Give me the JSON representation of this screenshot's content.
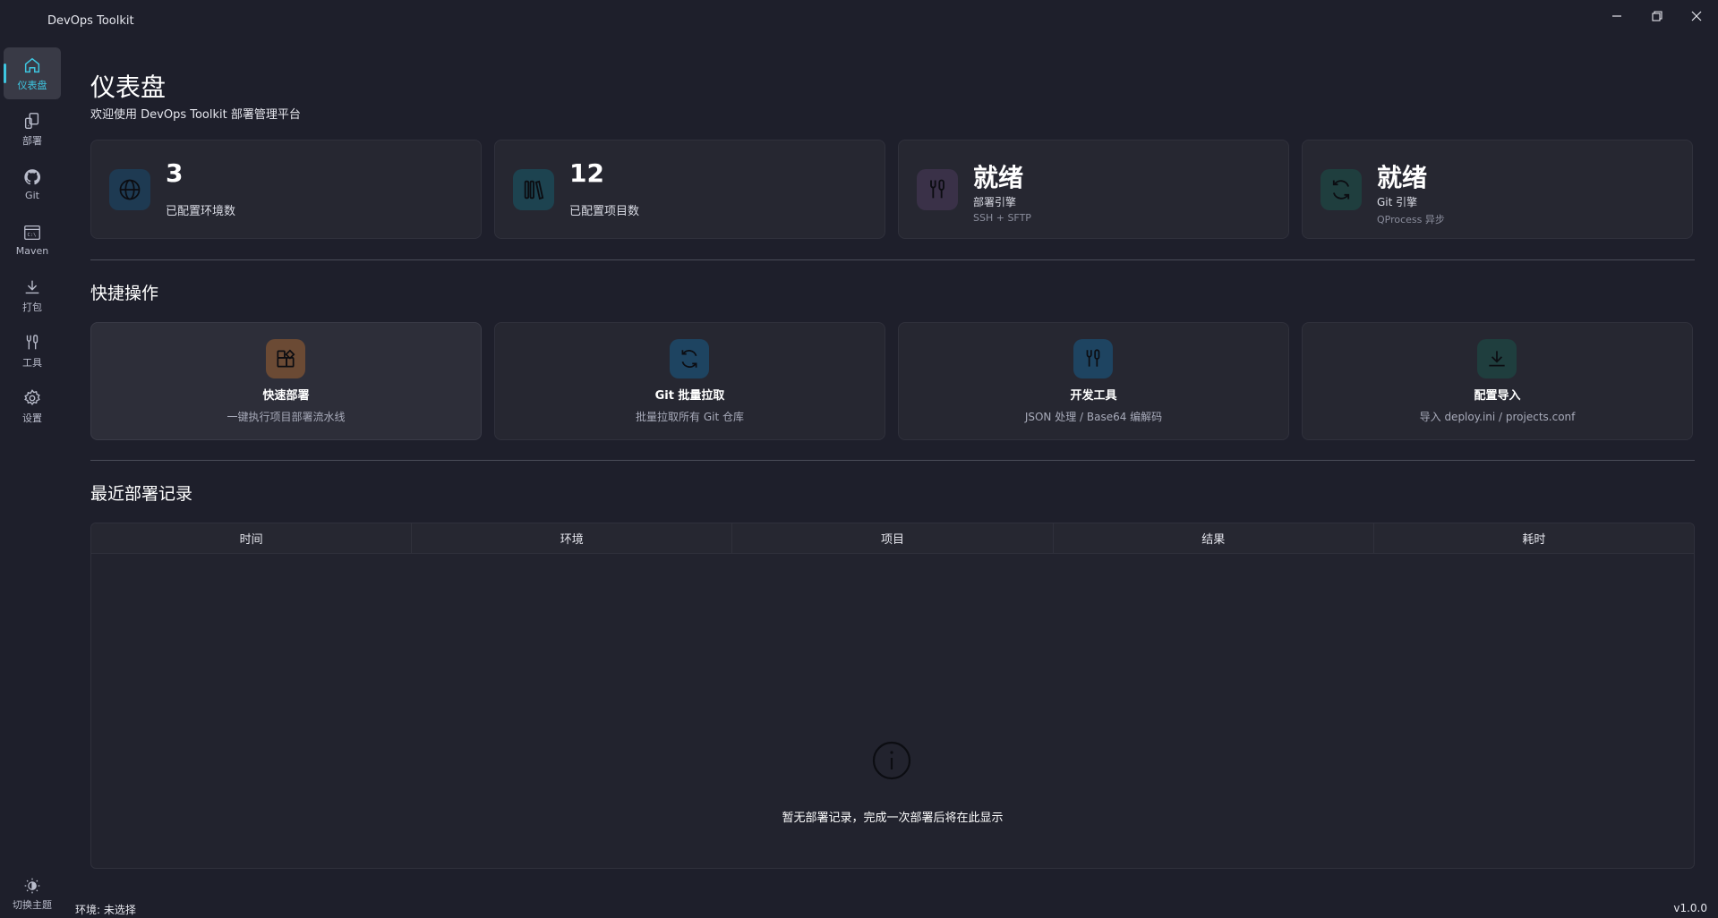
{
  "app": {
    "title": "DevOps Toolkit"
  },
  "sidebar": {
    "items": [
      {
        "label": "仪表盘",
        "icon": "home-icon"
      },
      {
        "label": "部署",
        "icon": "deploy-icon"
      },
      {
        "label": "Git",
        "icon": "github-icon"
      },
      {
        "label": "Maven",
        "icon": "terminal-icon"
      },
      {
        "label": "打包",
        "icon": "download-icon"
      },
      {
        "label": "工具",
        "icon": "tools-icon"
      },
      {
        "label": "设置",
        "icon": "gear-icon"
      }
    ],
    "theme_toggle_label": "切换主题"
  },
  "header": {
    "title": "仪表盘",
    "subtitle": "欢迎使用 DevOps Toolkit 部署管理平台"
  },
  "stats": [
    {
      "value": "3",
      "label": "已配置环境数",
      "icon": "globe-icon",
      "color": "#1e3a52"
    },
    {
      "value": "12",
      "label": "已配置项目数",
      "icon": "library-icon",
      "color": "#1d4350"
    },
    {
      "value": "就绪",
      "label": "部署引擎",
      "desc": "SSH + SFTP",
      "icon": "tools-icon",
      "color": "#3a3148"
    },
    {
      "value": "就绪",
      "label": "Git 引擎",
      "desc": "QProcess 异步",
      "icon": "sync-icon",
      "color": "#1f3e3e"
    }
  ],
  "quick_actions": {
    "title": "快捷操作",
    "items": [
      {
        "title": "快速部署",
        "desc": "一键执行项目部署流水线",
        "icon": "apps-add-icon",
        "color": "#6b4a34"
      },
      {
        "title": "Git 批量拉取",
        "desc": "批量拉取所有 Git 仓库",
        "icon": "sync-icon",
        "color": "#1e4461"
      },
      {
        "title": "开发工具",
        "desc": "JSON 处理 / Base64 编解码",
        "icon": "tools-icon",
        "color": "#1e4461"
      },
      {
        "title": "配置导入",
        "desc": "导入 deploy.ini / projects.conf",
        "icon": "download-icon",
        "color": "#1f3e3e"
      }
    ]
  },
  "recent": {
    "title": "最近部署记录",
    "columns": [
      "时间",
      "环境",
      "项目",
      "结果",
      "耗时"
    ],
    "empty_text": "暂无部署记录，完成一次部署后将在此显示"
  },
  "status": {
    "env": "环境: 未选择",
    "version": "v1.0.0"
  },
  "colors": {
    "accent": "#3ec6e0",
    "background": "#1e1f2b",
    "card": "#262731"
  }
}
